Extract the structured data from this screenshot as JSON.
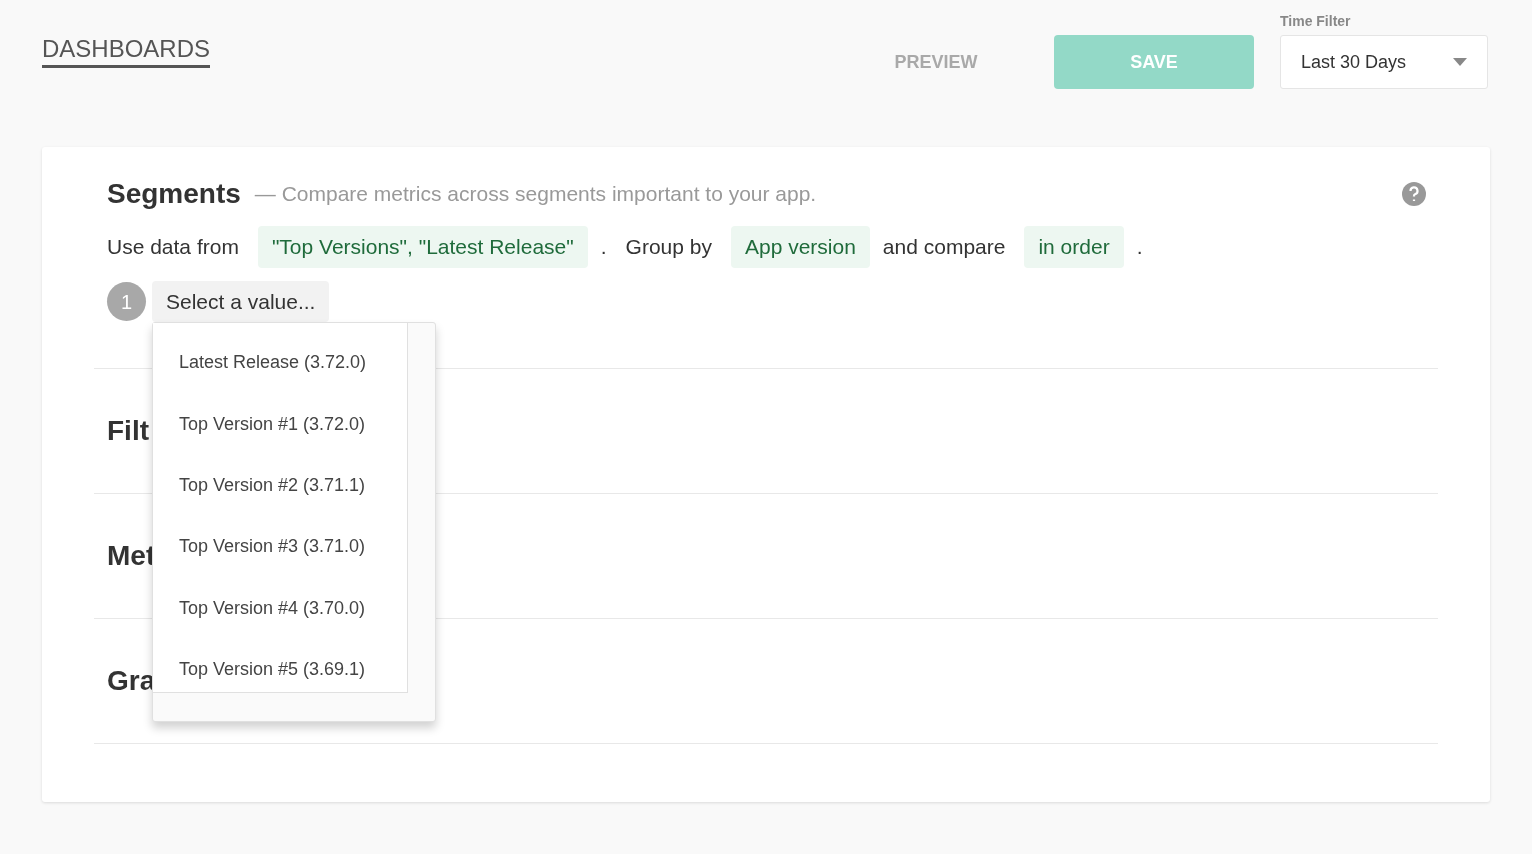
{
  "header": {
    "title": "DASHBOARDS",
    "preview_button": "PREVIEW",
    "save_button": "SAVE",
    "time_filter": {
      "label": "Time Filter",
      "value": "Last 30 Days"
    }
  },
  "segments": {
    "title": "Segments",
    "description": "— Compare metrics across segments important to your app.",
    "sentence": [
      {
        "kind": "text",
        "text": "Use data from"
      },
      {
        "kind": "chip",
        "text": "\"Top Versions\", \"Latest Release\""
      },
      {
        "kind": "text",
        "text": "."
      },
      {
        "kind": "text",
        "text": "Group by"
      },
      {
        "kind": "chip",
        "text": "App version"
      },
      {
        "kind": "text",
        "text": "and compare"
      },
      {
        "kind": "chip",
        "text": "in order"
      },
      {
        "kind": "text",
        "text": "."
      }
    ],
    "value_row": {
      "number": "1",
      "placeholder": "Select a value..."
    },
    "dropdown": {
      "open": true,
      "options": [
        "Latest Release (3.72.0)",
        "Top Version #1 (3.72.0)",
        "Top Version #2 (3.71.1)",
        "Top Version #3 (3.71.0)",
        "Top Version #4 (3.70.0)",
        "Top Version #5 (3.69.1)"
      ]
    }
  },
  "sections": [
    {
      "title": "Filt"
    },
    {
      "title": "Met"
    },
    {
      "title": "Gra"
    }
  ]
}
